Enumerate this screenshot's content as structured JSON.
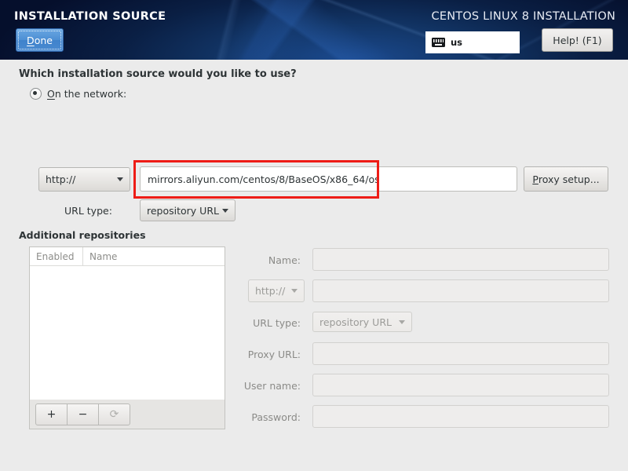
{
  "header": {
    "screen_title": "INSTALLATION SOURCE",
    "distro_title": "CENTOS LINUX 8 INSTALLATION",
    "done_label_accel": "D",
    "done_label_rest": "one",
    "keyboard_layout": "us",
    "keyboard_icon": "keyboard-icon",
    "help_label": "Help! (F1)"
  },
  "main": {
    "question": "Which installation source would you like to use?",
    "network_radio": {
      "accel": "O",
      "rest": "n the network:",
      "selected": true
    },
    "protocol_value": "http://",
    "url_value": "mirrors.aliyun.com/centos/8/BaseOS/x86_64/os",
    "proxy_setup_accel": "P",
    "proxy_setup_rest": "roxy setup...",
    "url_type_label": "URL type:",
    "url_type_value": "repository URL",
    "highlight_color": "#ee1c16"
  },
  "repositories": {
    "section_title": "Additional repositories",
    "columns": [
      "Enabled",
      "Name"
    ],
    "rows": [],
    "toolbar": [
      {
        "name": "add-repo-button",
        "glyph": "+"
      },
      {
        "name": "remove-repo-button",
        "glyph": "−"
      },
      {
        "name": "reset-repo-button",
        "glyph": "⟳"
      }
    ]
  },
  "repo_form": {
    "name_label": "Name:",
    "name_value": "",
    "protocol_value": "http://",
    "url_value": "",
    "url_type_label": "URL type:",
    "url_type_value": "repository URL",
    "proxy_url_label": "Proxy URL:",
    "proxy_url_value": "",
    "user_name_label": "User name:",
    "user_name_value": "",
    "password_label": "Password:",
    "password_value": ""
  }
}
